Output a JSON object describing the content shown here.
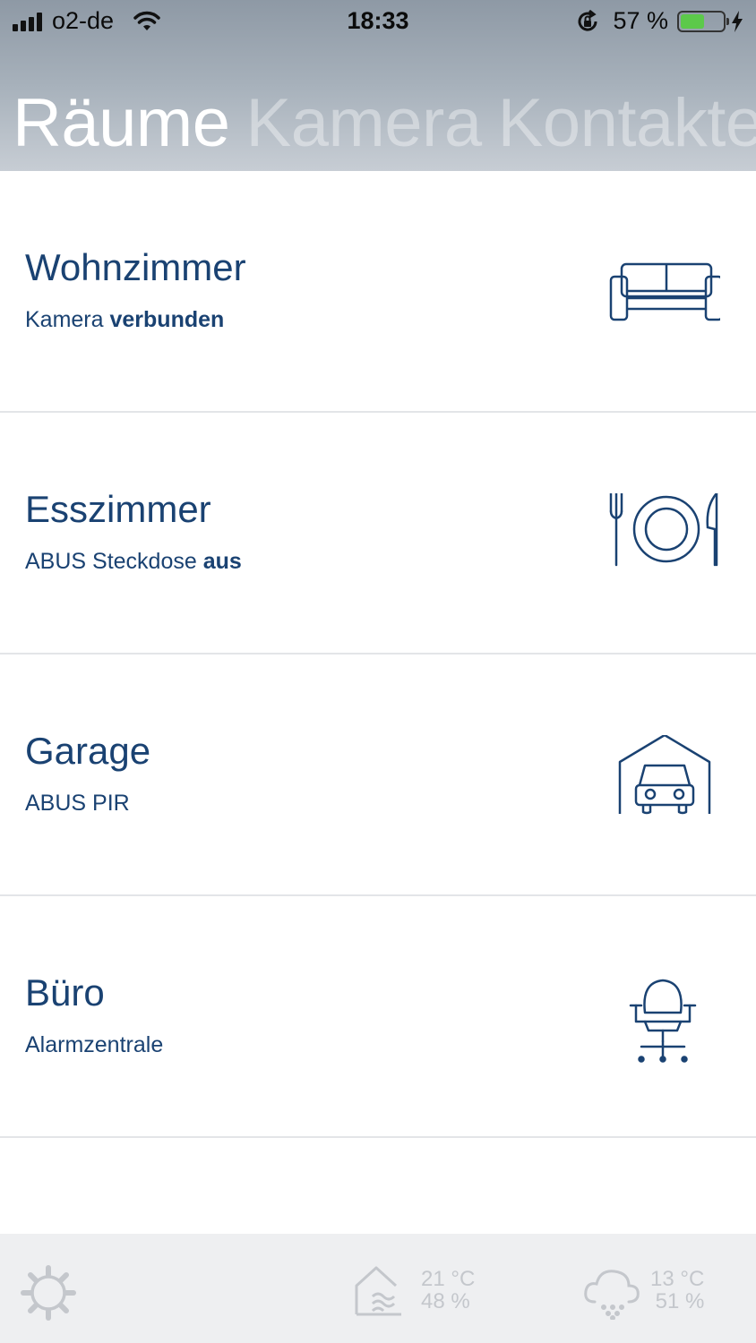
{
  "status_bar": {
    "carrier": "o2-de",
    "time": "18:33",
    "battery_percent": "57 %",
    "battery_level": 0.57
  },
  "tabs": [
    {
      "label": "Räume",
      "active": true
    },
    {
      "label": "Kamera",
      "active": false
    },
    {
      "label": "Kontakte",
      "active": false
    }
  ],
  "rooms": [
    {
      "name": "Wohnzimmer",
      "status_prefix": "Kamera ",
      "status_bold": "verbunden",
      "icon": "sofa-icon"
    },
    {
      "name": "Esszimmer",
      "status_prefix": "ABUS Steckdose ",
      "status_bold": "aus",
      "icon": "plate-cutlery-icon"
    },
    {
      "name": "Garage",
      "status_prefix": "ABUS PIR",
      "status_bold": "",
      "icon": "garage-car-icon"
    },
    {
      "name": "Büro",
      "status_prefix": "Alarmzentrale",
      "status_bold": "",
      "icon": "office-chair-icon"
    }
  ],
  "footer": {
    "indoor_temp": "21 °C",
    "indoor_humidity": "48 %",
    "outdoor_temp": "13 °C",
    "outdoor_humidity": "51 %"
  },
  "colors": {
    "accent": "#1a4272",
    "footer_text": "#c4c7cc",
    "battery": "#5cc94a"
  }
}
